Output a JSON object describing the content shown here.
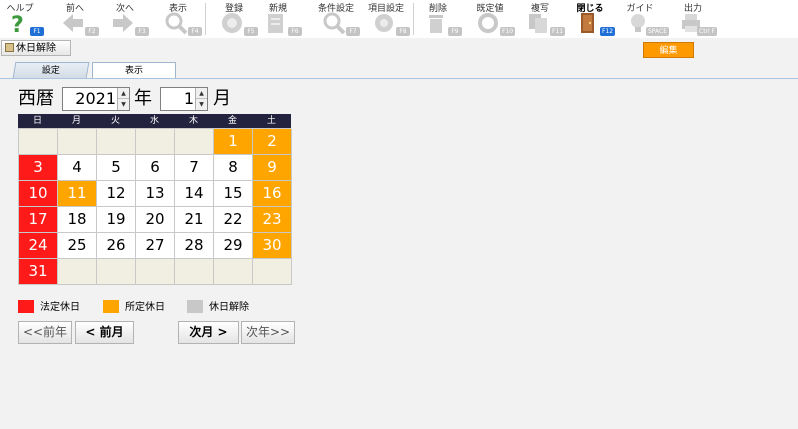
{
  "toolbar": {
    "help": {
      "label": "ヘルプ",
      "key": "F1"
    },
    "prev": {
      "label": "前へ",
      "key": "F2"
    },
    "next": {
      "label": "次へ",
      "key": "F3"
    },
    "view": {
      "label": "表示",
      "key": "F4"
    },
    "register": {
      "label": "登録",
      "key": "F5"
    },
    "new": {
      "label": "新規",
      "key": "F6"
    },
    "condition": {
      "label": "条件設定",
      "key": "F7"
    },
    "item_settings": {
      "label": "項目設定",
      "key": "F8"
    },
    "delete": {
      "label": "削除",
      "key": "F9"
    },
    "default": {
      "label": "既定値",
      "key": "F10"
    },
    "copy": {
      "label": "複写",
      "key": "F11"
    },
    "close": {
      "label": "閉じる",
      "key": "F12"
    },
    "guide": {
      "label": "ガイド",
      "key": "SPACE"
    },
    "output": {
      "label": "出力",
      "key": "Ctrl F"
    }
  },
  "holiday_clear_button": "休日解除",
  "edit_badge": "編集",
  "tabs": {
    "settings": "設定",
    "view": "表示"
  },
  "date_select": {
    "era_label": "西暦",
    "year": "2021",
    "year_unit": "年",
    "month": "1",
    "month_unit": "月"
  },
  "weekdays": [
    "日",
    "月",
    "火",
    "水",
    "木",
    "金",
    "土"
  ],
  "calendar": {
    "weeks": [
      [
        "",
        "",
        "",
        "",
        "",
        "1",
        "2"
      ],
      [
        "3",
        "4",
        "5",
        "6",
        "7",
        "8",
        "9"
      ],
      [
        "10",
        "11",
        "12",
        "13",
        "14",
        "15",
        "16"
      ],
      [
        "17",
        "18",
        "19",
        "20",
        "21",
        "22",
        "23"
      ],
      [
        "24",
        "25",
        "26",
        "27",
        "28",
        "29",
        "30"
      ],
      [
        "31",
        "",
        "",
        "",
        "",
        "",
        ""
      ]
    ],
    "legal_holidays": [
      "3",
      "10",
      "17",
      "24",
      "31"
    ],
    "designated_holidays": [
      "1",
      "2",
      "9",
      "11",
      "16",
      "23",
      "30"
    ]
  },
  "legend": {
    "legal": {
      "label": "法定休日",
      "color": "#ff1a1a"
    },
    "designated": {
      "label": "所定休日",
      "color": "#ffa500"
    },
    "cleared": {
      "label": "休日解除",
      "color": "#c8c8c8"
    }
  },
  "nav": {
    "prev_year": "<<前年",
    "prev_month": "< 前月",
    "next_month": "次月 >",
    "next_year": "次年>>"
  }
}
